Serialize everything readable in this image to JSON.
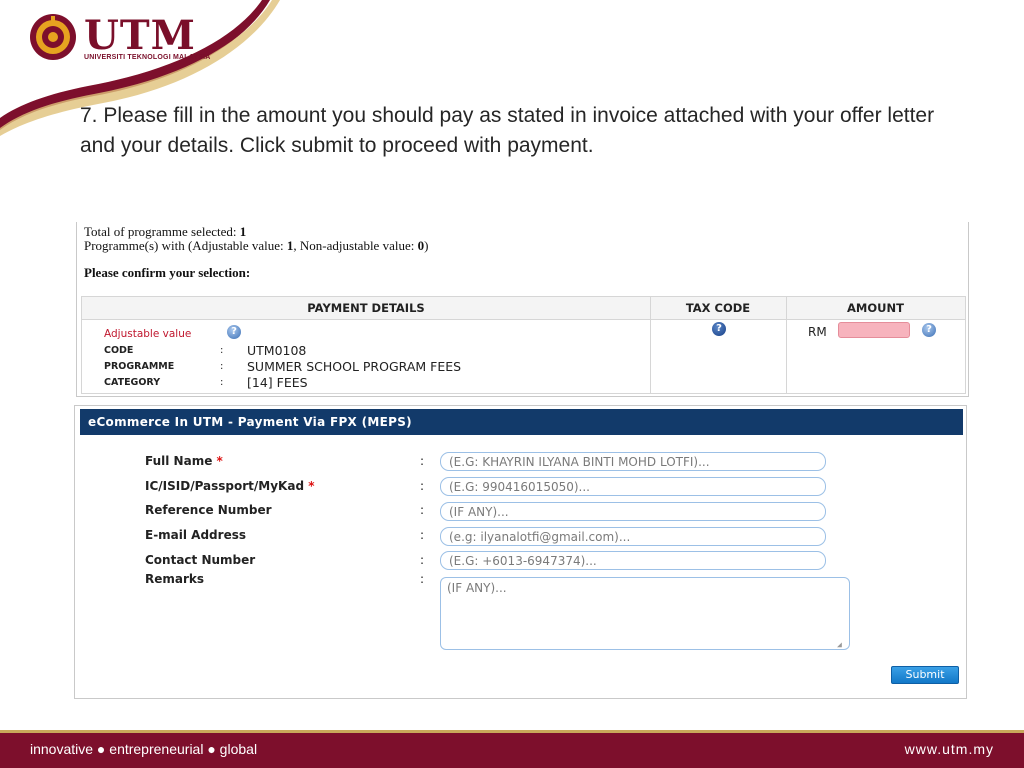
{
  "logo": {
    "title": "UTM",
    "subtitle": "UNIVERSITI TEKNOLOGI MALAYSIA"
  },
  "instruction": "7. Please fill in the amount you should pay as stated in invoice attached with your offer letter and your details. Click submit to proceed with payment.",
  "summary": {
    "line1_prefix": "Total of programme selected: ",
    "line1_value": "1",
    "line2_prefix": "Programme(s) with (Adjustable value: ",
    "line2_adjustable": "1",
    "line2_mid": ", Non-adjustable value: ",
    "line2_nonadjustable": "0",
    "line2_suffix": ")",
    "confirm": "Please confirm your selection:"
  },
  "payment_table": {
    "headers": [
      "PAYMENT DETAILS",
      "TAX CODE",
      "AMOUNT"
    ],
    "adjustable_label": "Adjustable value",
    "rows": [
      {
        "key": "CODE",
        "value": "UTM0108"
      },
      {
        "key": "PROGRAMME",
        "value": "SUMMER SCHOOL PROGRAM FEES"
      },
      {
        "key": "CATEGORY",
        "value": "[14] FEES"
      }
    ],
    "currency": "RM",
    "amount_value": ""
  },
  "form": {
    "header": "eCommerce In UTM - Payment Via FPX (MEPS)",
    "fields": [
      {
        "label": "Full Name",
        "required": true,
        "placeholder": "(E.G: KHAYRIN ILYANA BINTI MOHD LOTFI)..."
      },
      {
        "label": "IC/ISID/Passport/MyKad",
        "required": true,
        "placeholder": "(E.G: 990416015050)..."
      },
      {
        "label": "Reference Number",
        "required": false,
        "placeholder": "(IF ANY)..."
      },
      {
        "label": "E-mail Address",
        "required": false,
        "placeholder": "(e.g: ilyanalotfi@gmail.com)..."
      },
      {
        "label": "Contact Number",
        "required": false,
        "placeholder": "(E.G: +6013-6947374)..."
      }
    ],
    "remarks_label": "Remarks",
    "remarks_placeholder": "(IF ANY)...",
    "required_mark": "*",
    "colon": ":",
    "submit_label": "Submit"
  },
  "footer": {
    "tagline": "innovative ● entrepreneurial ● global",
    "url": "www.utm.my"
  },
  "colors": {
    "brand_maroon": "#7d0f2c",
    "brand_gold": "#c9a85a",
    "form_header_navy": "#123a6a",
    "amount_field_pink": "#f7b3bd"
  },
  "icons": [
    "utm-crest-icon",
    "help-icon",
    "tax-help-icon",
    "amount-help-icon"
  ]
}
